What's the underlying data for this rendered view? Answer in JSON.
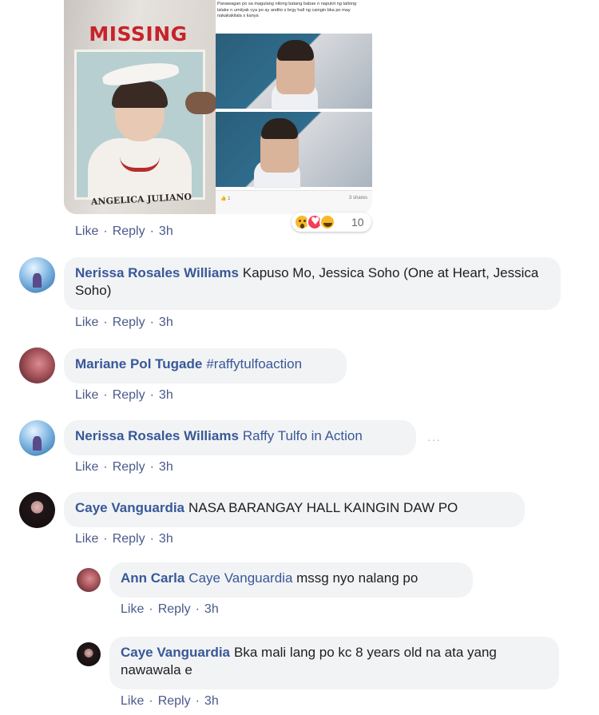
{
  "attachment": {
    "poster_title": "MISSING",
    "poster_name": "ANGELICA JULIANO",
    "post_caption": "Panawagan po sa magulang nitong batang babae n napulot ng tatlong lalake n umiiyak cya po ay andito s brgy hall ng caingin bka po may nakakakilala s kanya",
    "post_footer_left": "👍 1",
    "post_footer_right": "3 shares"
  },
  "reactions": {
    "icons": [
      "wow-icon",
      "love-icon",
      "haha-icon"
    ],
    "count": "10"
  },
  "action_labels": {
    "like": "Like",
    "reply": "Reply",
    "sep": "·"
  },
  "comments": [
    {
      "time": "3h"
    },
    {
      "author": "Nerissa Rosales Williams",
      "text": "Kapuso Mo, Jessica Soho (One at Heart, Jessica Soho)",
      "time": "3h"
    },
    {
      "author": "Mariane Pol Tugade",
      "text": "#raffytulfoaction",
      "time": "3h"
    },
    {
      "author": "Nerissa Rosales Williams",
      "text": "Raffy Tulfo in Action",
      "more": "···",
      "time": "3h"
    },
    {
      "author": "Caye Vanguardia",
      "text": "NASA BARANGAY HALL KAINGIN DAW PO",
      "time": "3h"
    }
  ],
  "replies": [
    {
      "author": "Ann Carla",
      "tag": "Caye Vanguardia",
      "text": "mssg nyo nalang po",
      "time": "3h"
    },
    {
      "author": "Caye Vanguardia",
      "text": "Bka mali lang po kc 8 years old na ata yang nawawala e",
      "time": "3h"
    }
  ],
  "colors": {
    "name_link": "#385898",
    "action_link": "#4b5a8a",
    "bubble_bg": "#f2f3f5",
    "missing_red": "#c7232a"
  }
}
